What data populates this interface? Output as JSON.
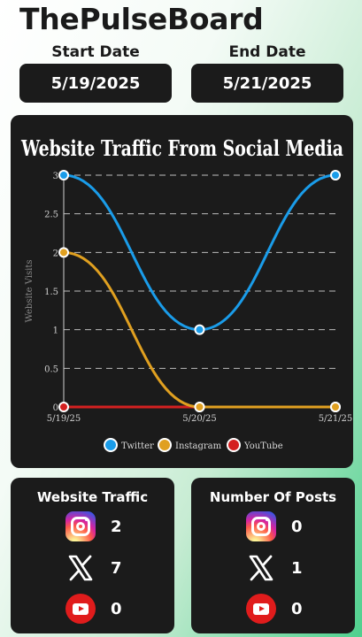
{
  "app": {
    "title": "ThePulseBoard"
  },
  "dates": {
    "start_label": "Start Date",
    "start_value": "5/19/2025",
    "end_label": "End Date",
    "end_value": "5/21/2025"
  },
  "chart_data": {
    "type": "line",
    "title": "Website Traffic From Social Media",
    "xlabel": "",
    "ylabel": "Website Visits",
    "categories": [
      "5/19/25",
      "5/20/25",
      "5/21/25"
    ],
    "ylim": [
      0,
      3
    ],
    "yticks": [
      "0",
      "0.5",
      "1",
      "1.5",
      "2",
      "2.5",
      "3"
    ],
    "grid": true,
    "legend_position": "bottom",
    "series": [
      {
        "name": "Twitter",
        "values": [
          3,
          1,
          3
        ],
        "color": "#1a9ce9"
      },
      {
        "name": "Instagram",
        "values": [
          2,
          0,
          0
        ],
        "color": "#e0a020"
      },
      {
        "name": "YouTube",
        "values": [
          0,
          0,
          0
        ],
        "color": "#d42020"
      }
    ]
  },
  "traffic_card": {
    "title": "Website Traffic",
    "rows": [
      {
        "icon": "instagram-icon",
        "value": "2"
      },
      {
        "icon": "x-icon",
        "value": "7"
      },
      {
        "icon": "youtube-icon",
        "value": "0"
      }
    ]
  },
  "posts_card": {
    "title": "Number Of Posts",
    "rows": [
      {
        "icon": "instagram-icon",
        "value": "0"
      },
      {
        "icon": "x-icon",
        "value": "1"
      },
      {
        "icon": "youtube-icon",
        "value": "0"
      }
    ]
  }
}
